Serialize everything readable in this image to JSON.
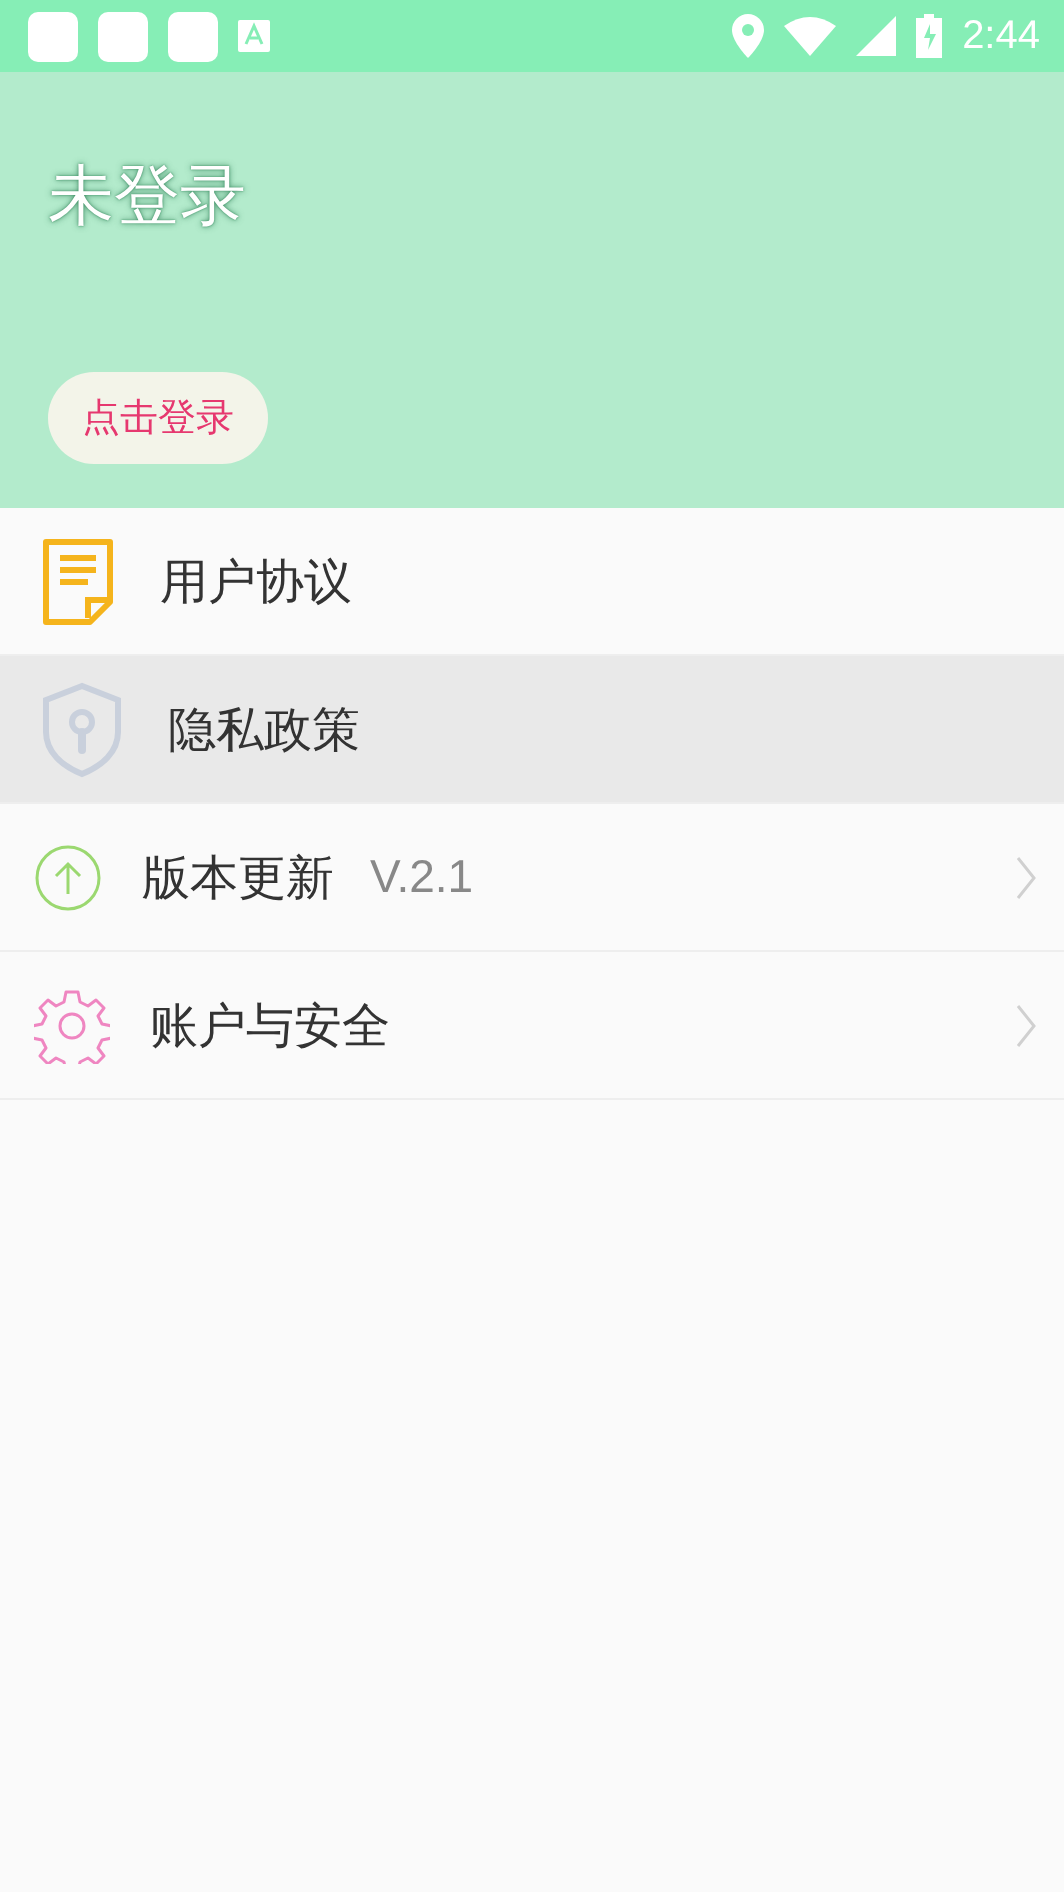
{
  "status_bar": {
    "time": "2:44"
  },
  "header": {
    "title": "未登录",
    "login_button": "点击登录"
  },
  "menu": [
    {
      "kind": "document",
      "label": "用户协议",
      "selected": false,
      "chevron": false
    },
    {
      "kind": "shield",
      "label": "隐私政策",
      "selected": true,
      "chevron": false
    },
    {
      "kind": "update",
      "label": "版本更新",
      "version": "V.2.1",
      "selected": false,
      "chevron": true
    },
    {
      "kind": "gear",
      "label": "账户与安全",
      "selected": false,
      "chevron": true
    }
  ]
}
